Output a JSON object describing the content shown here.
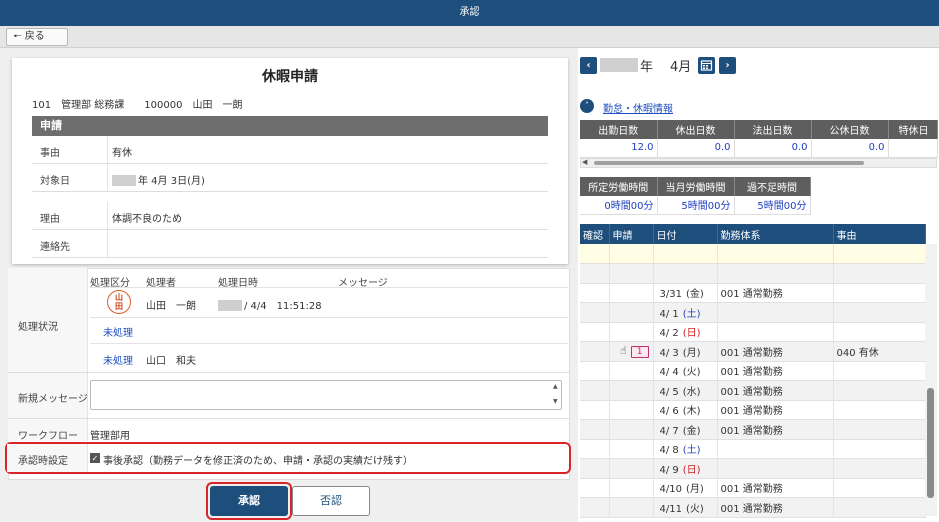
{
  "window": {
    "title": "承認"
  },
  "toolbar": {
    "back_label": "戻る"
  },
  "form": {
    "title": "休暇申請",
    "applicant": "101　管理部 総務課　　100000　山田　一朗",
    "section_label": "申請",
    "reason_label": "事由",
    "reason_value": "有休",
    "target_date_label": "対象日",
    "target_date_value": "年 4月 3日(月)",
    "cause_label": "理由",
    "cause_value": "体調不良のため",
    "contact_label": "連絡先",
    "contact_value": ""
  },
  "processing": {
    "status_label": "処理状況",
    "headers": [
      "処理区分",
      "処理者",
      "処理日時",
      "メッセージ"
    ],
    "stamp_text": "山\n田",
    "row1_processor": "山田　一朗",
    "row1_datetime": "/ 4/4　11:51:28",
    "row2_type": "未処理",
    "row3_type": "未処理",
    "row3_processor": "山口　和夫",
    "new_message_label": "新規メッセージ",
    "new_message_value": "",
    "workflow_label": "ワークフロー",
    "workflow_value": "管理部用",
    "approval_setting_label": "承認時設定",
    "approval_setting_text": "事後承認（勤務データを修正済のため、申請・承認の実績だけ残す）",
    "approval_setting_checked": true
  },
  "buttons": {
    "approve_label": "承認",
    "reject_label": "否認"
  },
  "calendar": {
    "year_suffix": "年",
    "month_label": "4月",
    "attendance_link": "勤怠・休暇情報",
    "summary_headers": [
      "出勤日数",
      "休出日数",
      "法出日数",
      "公休日数",
      "特休日"
    ],
    "summary_values": [
      "12.0",
      "0.0",
      "0.0",
      "0.0",
      ""
    ],
    "hours_headers": [
      "所定労働時間",
      "当月労働時間",
      "過不足時間"
    ],
    "hours_values": [
      "0時間00分",
      "5時間00分",
      "5時間00分"
    ],
    "table_headers": [
      "確認",
      "申請",
      "日付",
      "勤務体系",
      "事由"
    ],
    "rows": [
      {
        "date": "",
        "dow": "",
        "dow_type": "",
        "shift": "",
        "reason": "",
        "badge": ""
      },
      {
        "date": "",
        "dow": "",
        "dow_type": "",
        "shift": "",
        "reason": "",
        "badge": ""
      },
      {
        "date": "3/31",
        "dow": "(金)",
        "dow_type": "weekday",
        "shift": "001 通常勤務",
        "reason": "",
        "badge": ""
      },
      {
        "date": "4/ 1",
        "dow": "(土)",
        "dow_type": "sat",
        "shift": "",
        "reason": "",
        "badge": ""
      },
      {
        "date": "4/ 2",
        "dow": "(日)",
        "dow_type": "sun",
        "shift": "",
        "reason": "",
        "badge": ""
      },
      {
        "date": "4/ 3",
        "dow": "(月)",
        "dow_type": "weekday",
        "shift": "001 通常勤務",
        "reason": "040 有休",
        "badge": "1"
      },
      {
        "date": "4/ 4",
        "dow": "(火)",
        "dow_type": "weekday",
        "shift": "001 通常勤務",
        "reason": "",
        "badge": ""
      },
      {
        "date": "4/ 5",
        "dow": "(水)",
        "dow_type": "weekday",
        "shift": "001 通常勤務",
        "reason": "",
        "badge": ""
      },
      {
        "date": "4/ 6",
        "dow": "(木)",
        "dow_type": "weekday",
        "shift": "001 通常勤務",
        "reason": "",
        "badge": ""
      },
      {
        "date": "4/ 7",
        "dow": "(金)",
        "dow_type": "weekday",
        "shift": "001 通常勤務",
        "reason": "",
        "badge": ""
      },
      {
        "date": "4/ 8",
        "dow": "(土)",
        "dow_type": "sat",
        "shift": "",
        "reason": "",
        "badge": ""
      },
      {
        "date": "4/ 9",
        "dow": "(日)",
        "dow_type": "sun",
        "shift": "",
        "reason": "",
        "badge": ""
      },
      {
        "date": "4/10",
        "dow": "(月)",
        "dow_type": "weekday",
        "shift": "001 通常勤務",
        "reason": "",
        "badge": ""
      },
      {
        "date": "4/11",
        "dow": "(火)",
        "dow_type": "weekday",
        "shift": "001 通常勤務",
        "reason": "",
        "badge": ""
      }
    ]
  },
  "colors": {
    "primary": "#1e4f7c",
    "highlight": "#d8252a",
    "link": "#1f4fbf",
    "sunday": "#d02020"
  }
}
